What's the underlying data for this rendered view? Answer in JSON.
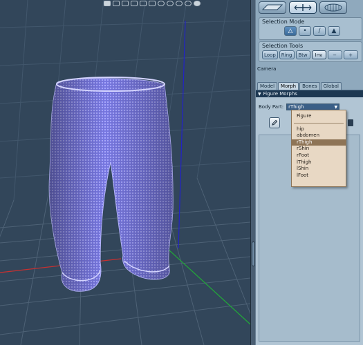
{
  "viewport": {
    "topbar_icons": [
      "render-icon",
      "grid-icon",
      "grid-icon",
      "grid-icon",
      "lights-icon",
      "lights-icon",
      "globe-icon",
      "globe-icon",
      "globe-icon",
      "globe-icon",
      "sphere-icon"
    ]
  },
  "panel": {
    "selection_mode": {
      "title": "Selection Mode"
    },
    "selection_tools": {
      "title": "Selection Tools",
      "buttons": [
        "Loop",
        "Ring",
        "Btw",
        "Inv",
        "−",
        "+"
      ],
      "active": "Inv"
    },
    "camera_label": "Camera",
    "tabs": [
      "Model",
      "Morph",
      "Bones",
      "Global"
    ],
    "active_tab": "Morph",
    "figure_morphs": {
      "header": "Figure Morphs",
      "body_part_label": "Body Part:",
      "body_part_value": "rThigh"
    }
  },
  "dropdown": {
    "items": [
      "Figure",
      "hip",
      "abdomen",
      "rThigh",
      "rShin",
      "rFoot",
      "lThigh",
      "lShin",
      "lFoot"
    ],
    "selected": "rThigh"
  },
  "colors": {
    "viewport_bg": "#32465a",
    "mesh": "#8f8ff5",
    "panel_bg": "#8fa9bd",
    "dropdown_bg": "#e8d8c4",
    "dropdown_selected": "#8e7456"
  }
}
